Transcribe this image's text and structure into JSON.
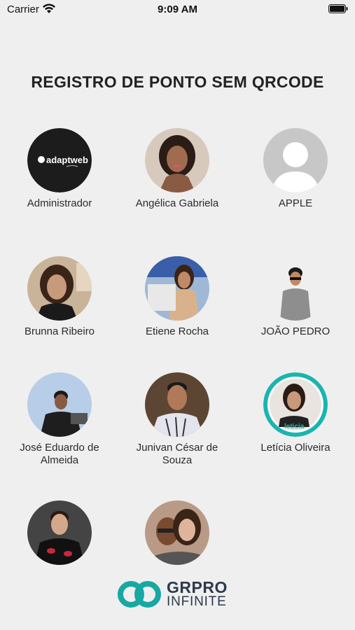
{
  "status_bar": {
    "carrier": "Carrier",
    "time": "9:09 AM"
  },
  "title": "REGISTRO DE PONTO SEM QRCODE",
  "users": [
    {
      "name": "Administrador",
      "avatar": "adaptweb-logo"
    },
    {
      "name": "Angélica Gabriela",
      "avatar": "photo-woman"
    },
    {
      "name": "APPLE",
      "avatar": "default-person-icon"
    },
    {
      "name": "Brunna Ribeiro",
      "avatar": "photo-woman"
    },
    {
      "name": "Etiene Rocha",
      "avatar": "photo-woman-laptop"
    },
    {
      "name": "JOÃO PEDRO",
      "avatar": "photo-man-sunglasses"
    },
    {
      "name": "José Eduardo de Almeida",
      "avatar": "photo-man-laptop"
    },
    {
      "name": "Junivan César de Souza",
      "avatar": "photo-man"
    },
    {
      "name": "Letícia Oliveira",
      "avatar": "photo-woman-badge",
      "badge": "leticia"
    },
    {
      "name": "",
      "avatar": "photo-young-man"
    },
    {
      "name": "",
      "avatar": "photo-couple"
    }
  ],
  "avatar_logo_text": "adaptweb",
  "brand": {
    "line1": "GRPRO",
    "line2": "INFINITE",
    "color": "#17a8a3"
  }
}
